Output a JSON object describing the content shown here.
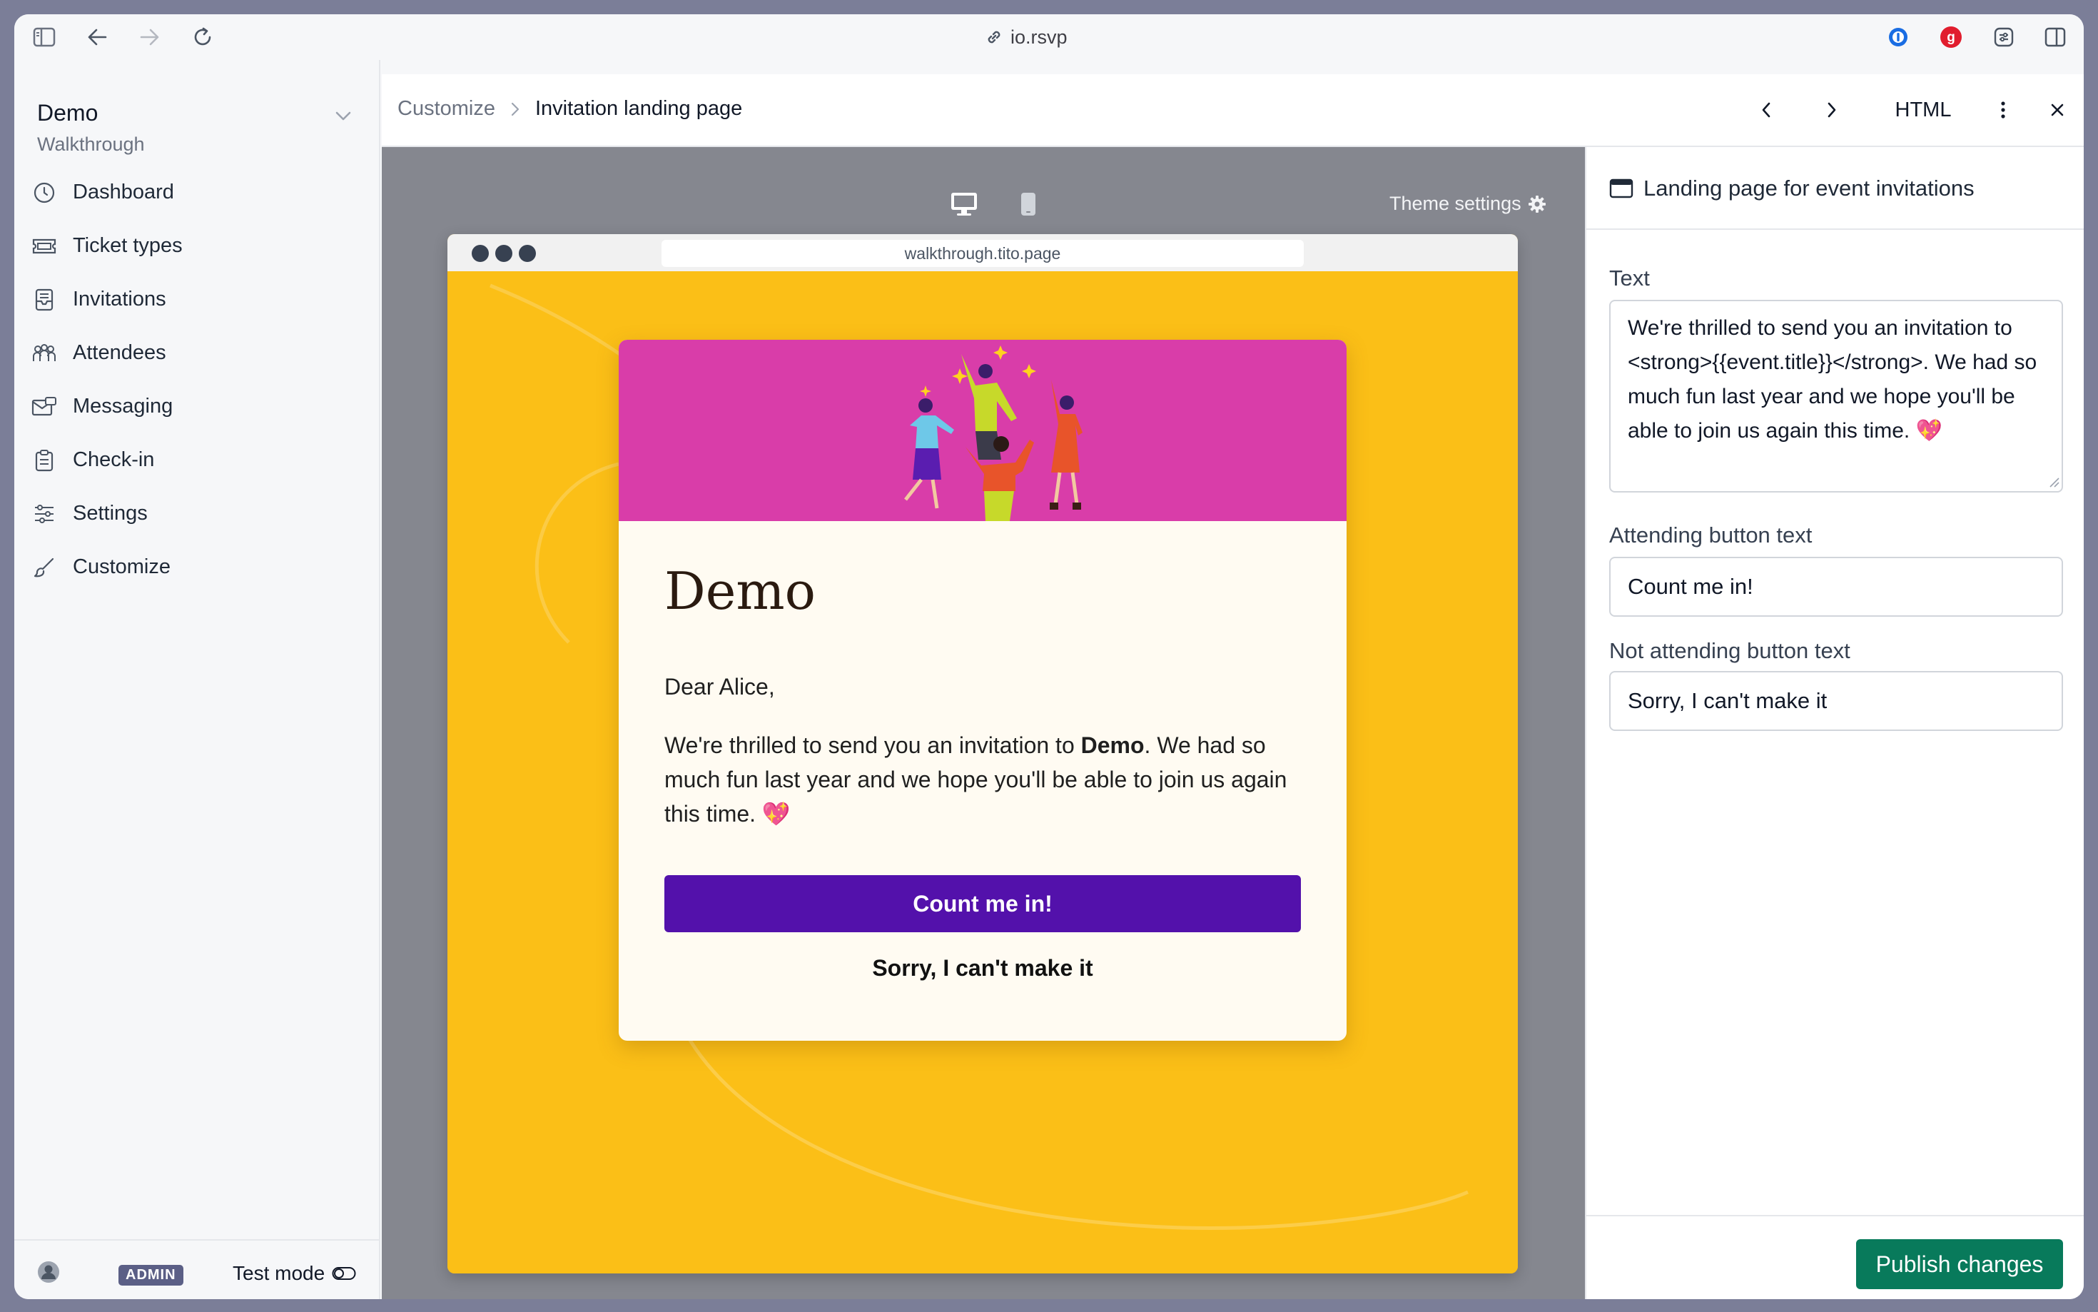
{
  "browser": {
    "url": "io.rsvp"
  },
  "sidebar": {
    "org_name": "Demo",
    "org_sub": "Walkthrough",
    "items": [
      {
        "label": "Dashboard",
        "icon": "dashboard-icon"
      },
      {
        "label": "Ticket types",
        "icon": "ticket-icon"
      },
      {
        "label": "Invitations",
        "icon": "inbox-icon"
      },
      {
        "label": "Attendees",
        "icon": "people-icon"
      },
      {
        "label": "Messaging",
        "icon": "mail-icon"
      },
      {
        "label": "Check-in",
        "icon": "clipboard-icon"
      },
      {
        "label": "Settings",
        "icon": "sliders-icon"
      },
      {
        "label": "Customize",
        "icon": "brush-icon"
      }
    ],
    "footer": {
      "badge": "ADMIN",
      "test_mode": "Test mode"
    }
  },
  "header": {
    "breadcrumb_parent": "Customize",
    "breadcrumb_current": "Invitation landing page",
    "html_label": "HTML"
  },
  "preview": {
    "theme_settings": "Theme settings",
    "mock_url": "walkthrough.tito.page",
    "card": {
      "title": "Demo",
      "greeting": "Dear Alice,",
      "text_before": "We're thrilled to send you an invitation to ",
      "text_bold": "Demo",
      "text_after": ". We had so much fun last year and we hope you'll be able to join us again this time. 💖",
      "attending_button": "Count me in!",
      "not_attending_button": "Sorry, I can't make it"
    },
    "colors": {
      "page_bg": "#fbbf17",
      "hero_bg": "#d93da9",
      "primary_button": "#5311ab"
    }
  },
  "panel": {
    "title": "Landing page for event invitations",
    "text_label": "Text",
    "text_value": "We're thrilled to send you an invitation to <strong>{{event.title}}</strong>. We had so much fun last year and we hope you'll be able to join us again this time. 💖",
    "attending_label": "Attending button text",
    "attending_value": "Count me in!",
    "not_attending_label": "Not attending button text",
    "not_attending_value": "Sorry, I can't make it",
    "publish_label": "Publish changes"
  }
}
